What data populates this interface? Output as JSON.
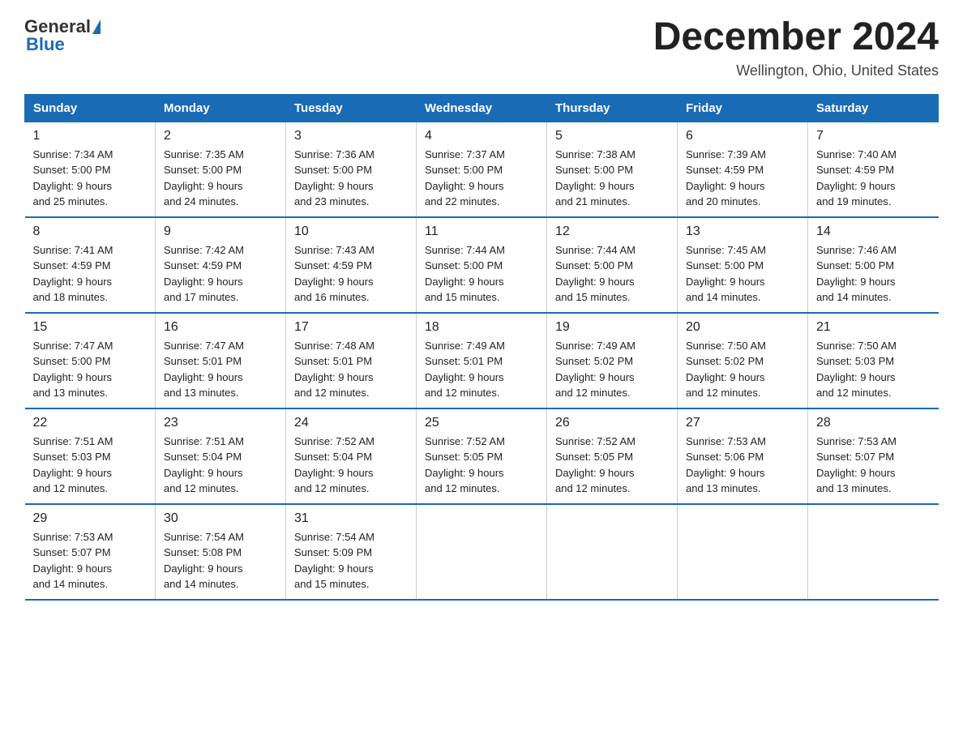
{
  "header": {
    "logo_general": "General",
    "logo_blue": "Blue",
    "title": "December 2024",
    "subtitle": "Wellington, Ohio, United States"
  },
  "days_of_week": [
    "Sunday",
    "Monday",
    "Tuesday",
    "Wednesday",
    "Thursday",
    "Friday",
    "Saturday"
  ],
  "weeks": [
    [
      {
        "day": 1,
        "sunrise": "7:34 AM",
        "sunset": "5:00 PM",
        "daylight": "9 hours and 25 minutes."
      },
      {
        "day": 2,
        "sunrise": "7:35 AM",
        "sunset": "5:00 PM",
        "daylight": "9 hours and 24 minutes."
      },
      {
        "day": 3,
        "sunrise": "7:36 AM",
        "sunset": "5:00 PM",
        "daylight": "9 hours and 23 minutes."
      },
      {
        "day": 4,
        "sunrise": "7:37 AM",
        "sunset": "5:00 PM",
        "daylight": "9 hours and 22 minutes."
      },
      {
        "day": 5,
        "sunrise": "7:38 AM",
        "sunset": "5:00 PM",
        "daylight": "9 hours and 21 minutes."
      },
      {
        "day": 6,
        "sunrise": "7:39 AM",
        "sunset": "4:59 PM",
        "daylight": "9 hours and 20 minutes."
      },
      {
        "day": 7,
        "sunrise": "7:40 AM",
        "sunset": "4:59 PM",
        "daylight": "9 hours and 19 minutes."
      }
    ],
    [
      {
        "day": 8,
        "sunrise": "7:41 AM",
        "sunset": "4:59 PM",
        "daylight": "9 hours and 18 minutes."
      },
      {
        "day": 9,
        "sunrise": "7:42 AM",
        "sunset": "4:59 PM",
        "daylight": "9 hours and 17 minutes."
      },
      {
        "day": 10,
        "sunrise": "7:43 AM",
        "sunset": "4:59 PM",
        "daylight": "9 hours and 16 minutes."
      },
      {
        "day": 11,
        "sunrise": "7:44 AM",
        "sunset": "5:00 PM",
        "daylight": "9 hours and 15 minutes."
      },
      {
        "day": 12,
        "sunrise": "7:44 AM",
        "sunset": "5:00 PM",
        "daylight": "9 hours and 15 minutes."
      },
      {
        "day": 13,
        "sunrise": "7:45 AM",
        "sunset": "5:00 PM",
        "daylight": "9 hours and 14 minutes."
      },
      {
        "day": 14,
        "sunrise": "7:46 AM",
        "sunset": "5:00 PM",
        "daylight": "9 hours and 14 minutes."
      }
    ],
    [
      {
        "day": 15,
        "sunrise": "7:47 AM",
        "sunset": "5:00 PM",
        "daylight": "9 hours and 13 minutes."
      },
      {
        "day": 16,
        "sunrise": "7:47 AM",
        "sunset": "5:01 PM",
        "daylight": "9 hours and 13 minutes."
      },
      {
        "day": 17,
        "sunrise": "7:48 AM",
        "sunset": "5:01 PM",
        "daylight": "9 hours and 12 minutes."
      },
      {
        "day": 18,
        "sunrise": "7:49 AM",
        "sunset": "5:01 PM",
        "daylight": "9 hours and 12 minutes."
      },
      {
        "day": 19,
        "sunrise": "7:49 AM",
        "sunset": "5:02 PM",
        "daylight": "9 hours and 12 minutes."
      },
      {
        "day": 20,
        "sunrise": "7:50 AM",
        "sunset": "5:02 PM",
        "daylight": "9 hours and 12 minutes."
      },
      {
        "day": 21,
        "sunrise": "7:50 AM",
        "sunset": "5:03 PM",
        "daylight": "9 hours and 12 minutes."
      }
    ],
    [
      {
        "day": 22,
        "sunrise": "7:51 AM",
        "sunset": "5:03 PM",
        "daylight": "9 hours and 12 minutes."
      },
      {
        "day": 23,
        "sunrise": "7:51 AM",
        "sunset": "5:04 PM",
        "daylight": "9 hours and 12 minutes."
      },
      {
        "day": 24,
        "sunrise": "7:52 AM",
        "sunset": "5:04 PM",
        "daylight": "9 hours and 12 minutes."
      },
      {
        "day": 25,
        "sunrise": "7:52 AM",
        "sunset": "5:05 PM",
        "daylight": "9 hours and 12 minutes."
      },
      {
        "day": 26,
        "sunrise": "7:52 AM",
        "sunset": "5:05 PM",
        "daylight": "9 hours and 12 minutes."
      },
      {
        "day": 27,
        "sunrise": "7:53 AM",
        "sunset": "5:06 PM",
        "daylight": "9 hours and 13 minutes."
      },
      {
        "day": 28,
        "sunrise": "7:53 AM",
        "sunset": "5:07 PM",
        "daylight": "9 hours and 13 minutes."
      }
    ],
    [
      {
        "day": 29,
        "sunrise": "7:53 AM",
        "sunset": "5:07 PM",
        "daylight": "9 hours and 14 minutes."
      },
      {
        "day": 30,
        "sunrise": "7:54 AM",
        "sunset": "5:08 PM",
        "daylight": "9 hours and 14 minutes."
      },
      {
        "day": 31,
        "sunrise": "7:54 AM",
        "sunset": "5:09 PM",
        "daylight": "9 hours and 15 minutes."
      },
      null,
      null,
      null,
      null
    ]
  ]
}
